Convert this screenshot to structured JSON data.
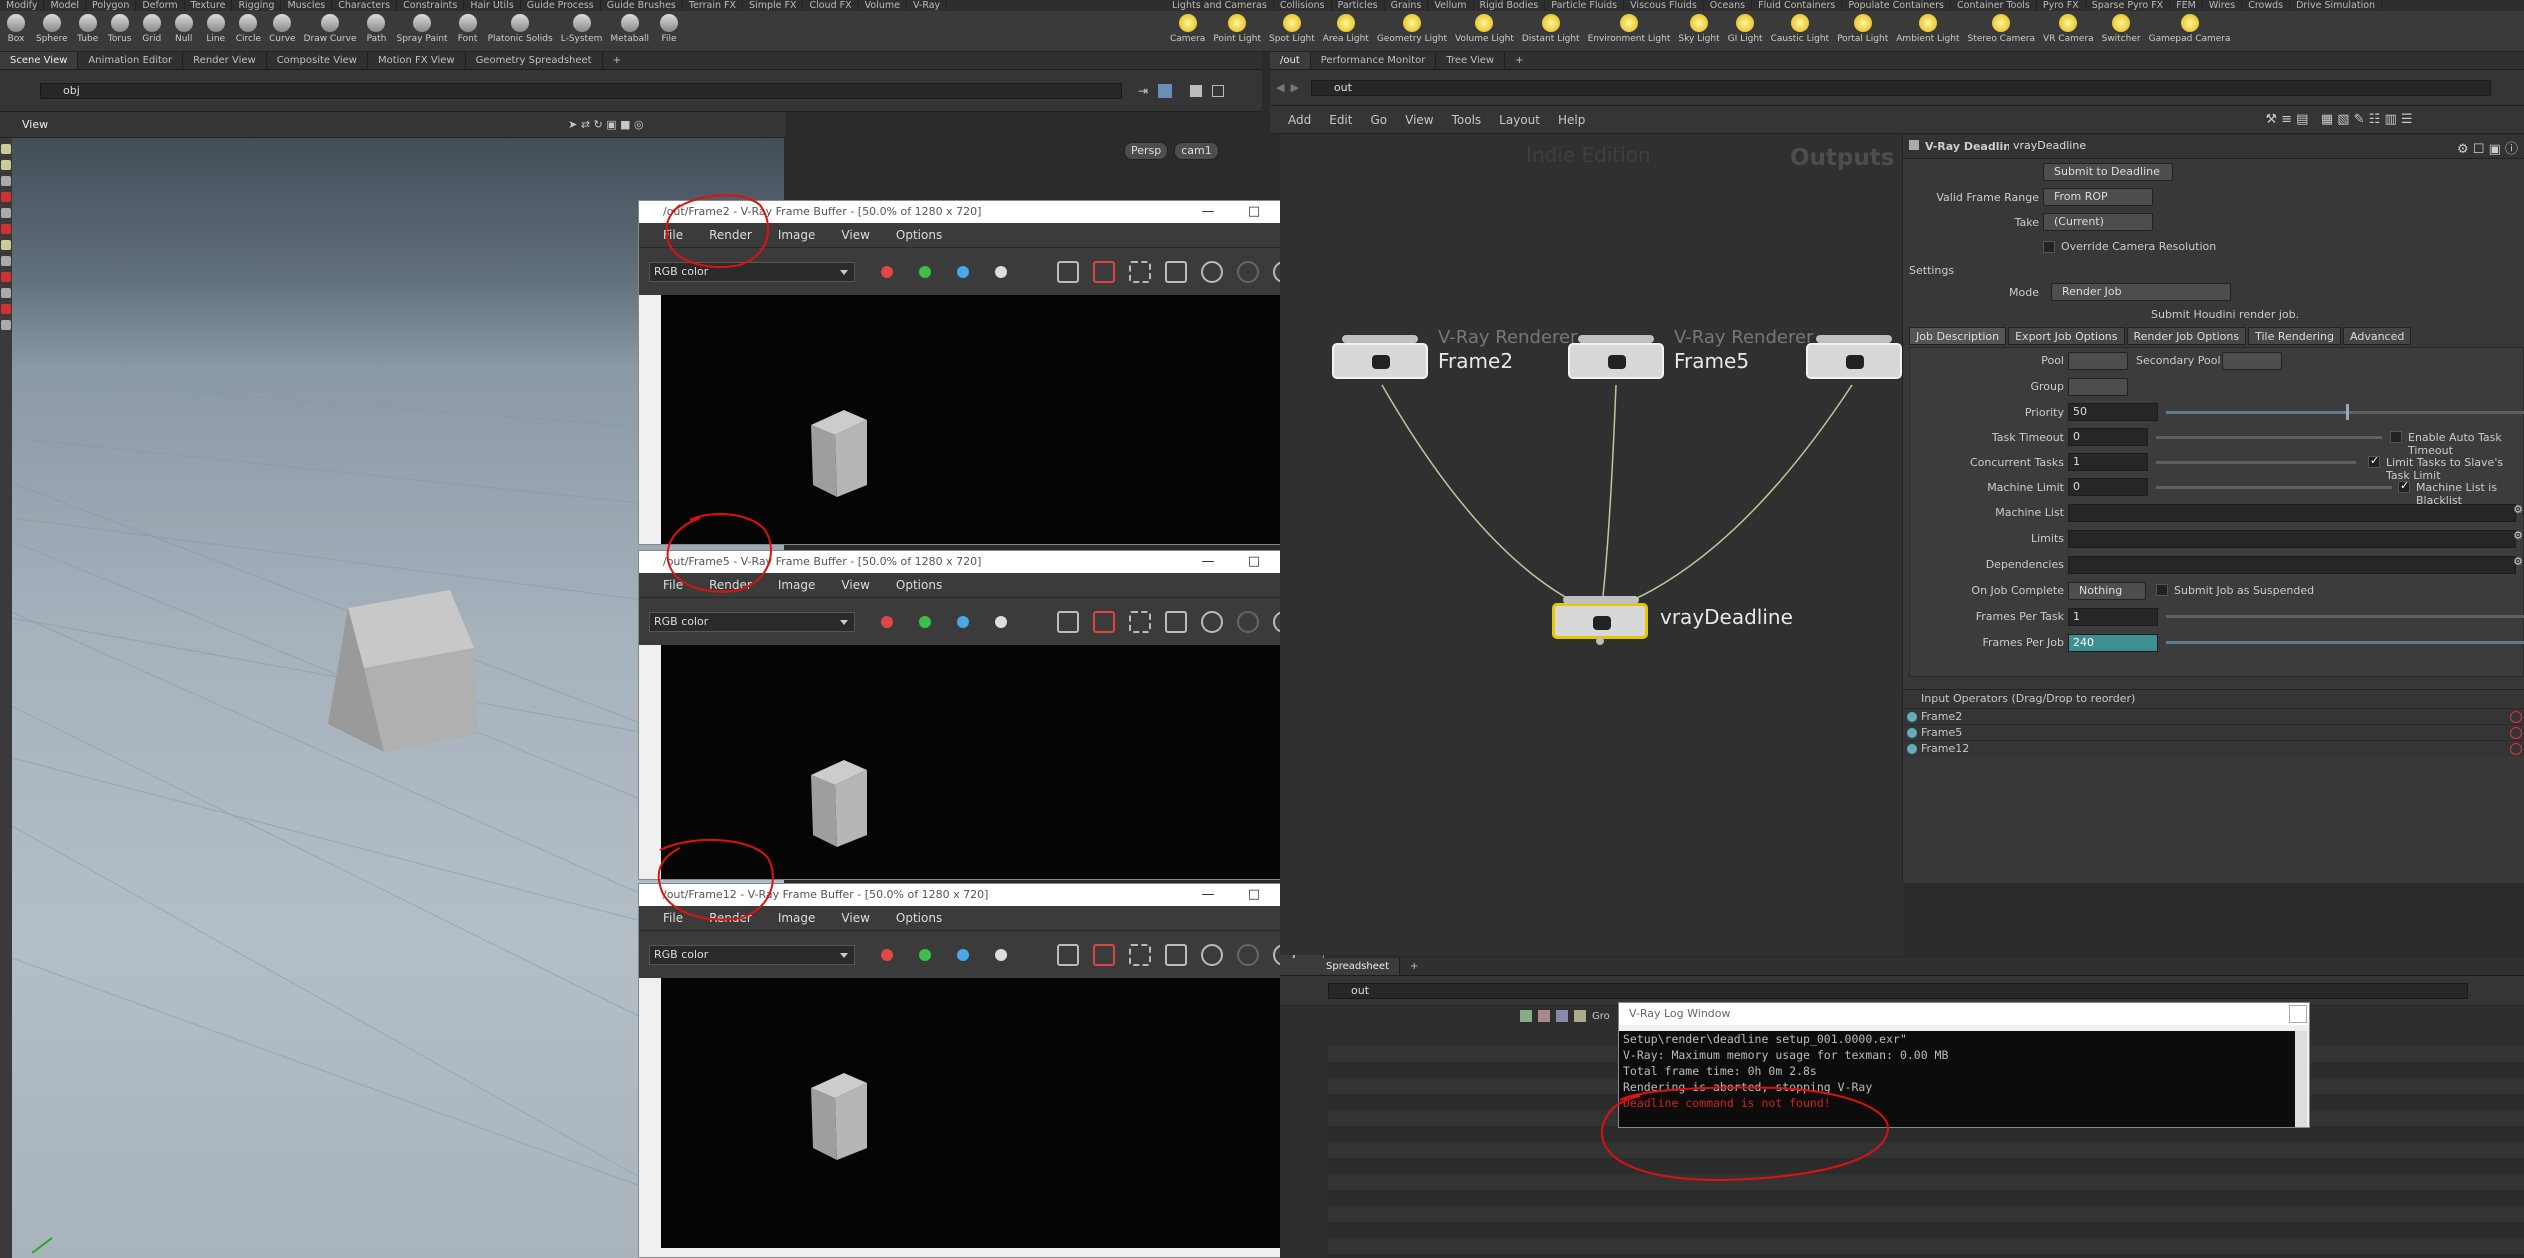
{
  "shelf_left": {
    "tabs": [
      "Modify",
      "Model",
      "Polygon",
      "Deform",
      "Texture",
      "Rigging",
      "Muscles",
      "Characters",
      "Constraints",
      "Hair Utils",
      "Guide Process",
      "Guide Brushes",
      "Terrain FX",
      "Simple FX",
      "Cloud FX",
      "Volume",
      "V-Ray"
    ],
    "tools": [
      "Box",
      "Sphere",
      "Tube",
      "Torus",
      "Grid",
      "Null",
      "Line",
      "Circle",
      "Curve",
      "Draw Curve",
      "Path",
      "Spray Paint",
      "Font",
      "Platonic Solids",
      "L-System",
      "Metaball",
      "File"
    ]
  },
  "shelf_right": {
    "tabs": [
      "Lights and Cameras",
      "Collisions",
      "Particles",
      "Grains",
      "Vellum",
      "Rigid Bodies",
      "Particle Fluids",
      "Viscous Fluids",
      "Oceans",
      "Fluid Containers",
      "Populate Containers",
      "Container Tools",
      "Pyro FX",
      "Sparse Pyro FX",
      "FEM",
      "Wires",
      "Crowds",
      "Drive Simulation"
    ],
    "tools": [
      "Camera",
      "Point Light",
      "Spot Light",
      "Area Light",
      "Geometry Light",
      "Volume Light",
      "Distant Light",
      "Environment Light",
      "Sky Light",
      "GI Light",
      "Caustic Light",
      "Portal Light",
      "Ambient Light",
      "Stereo Camera",
      "VR Camera",
      "Switcher",
      "Gamepad Camera"
    ]
  },
  "left_pane": {
    "tabs": [
      "Scene View",
      "Animation Editor",
      "Render View",
      "Composite View",
      "Motion FX View",
      "Geometry Spreadsheet"
    ],
    "path": "obj",
    "view_label": "View",
    "persp": "Persp",
    "camera": "cam1"
  },
  "vfb_windows": [
    {
      "title": "/out/Frame2 - V-Ray Frame Buffer - [50.0% of 1280 x 720]"
    },
    {
      "title": "/out/Frame5 - V-Ray Frame Buffer - [50.0% of 1280 x 720]"
    },
    {
      "title": "/out/Frame12 - V-Ray Frame Buffer - [50.0% of 1280 x 720]"
    }
  ],
  "vfb_menu": {
    "file": "File",
    "render": "Render",
    "image": "Image",
    "view": "View",
    "options": "Options"
  },
  "vfb_channel": "RGB color",
  "vfb_colors": {
    "red": "#e04848",
    "green": "#3cc048",
    "blue": "#48a8e8"
  },
  "right_pane": {
    "tabs": [
      "/out",
      "Performance Monitor",
      "Tree View"
    ],
    "path": "out",
    "menu": [
      "Add",
      "Edit",
      "Go",
      "View",
      "Tools",
      "Layout",
      "Help"
    ],
    "watermark": "Indie Edition",
    "context": "Outputs"
  },
  "nodes": [
    {
      "type": "V-Ray Renderer",
      "name": "Frame2"
    },
    {
      "type": "V-Ray Renderer",
      "name": "Frame5"
    },
    {
      "type": "",
      "name": ""
    },
    {
      "type": "",
      "name": "vrayDeadline"
    }
  ],
  "params": {
    "node_type": "V-Ray Deadline",
    "node_name": "vrayDeadline",
    "submit_button": "Submit to Deadline",
    "valid_frame_range_label": "Valid Frame Range",
    "valid_frame_range": "From ROP",
    "take_label": "Take",
    "take": "(Current)",
    "override_camera": "Override Camera Resolution",
    "settings_label": "Settings",
    "mode_label": "Mode",
    "mode": "Render Job",
    "mode_desc": "Submit Houdini render job.",
    "tabs": [
      "Job Description",
      "Export Job Options",
      "Render Job Options",
      "Tile Rendering",
      "Advanced"
    ],
    "pool_label": "Pool",
    "secondary_pool_label": "Secondary Pool",
    "group_label": "Group",
    "priority_label": "Priority",
    "priority": "50",
    "task_timeout_label": "Task Timeout",
    "task_timeout": "0",
    "enable_auto_timeout": "Enable Auto Task Timeout",
    "concurrent_label": "Concurrent Tasks",
    "concurrent": "1",
    "limit_slave": "Limit Tasks to Slave's Task Limit",
    "machine_limit_label": "Machine Limit",
    "machine_limit": "0",
    "machine_blacklist": "Machine List is Blacklist",
    "machine_list_label": "Machine List",
    "limits_label": "Limits",
    "dependencies_label": "Dependencies",
    "on_complete_label": "On Job Complete",
    "on_complete": "Nothing",
    "submit_suspended": "Submit Job as Suspended",
    "frames_per_task_label": "Frames Per Task",
    "frames_per_task": "1",
    "frames_per_job_label": "Frames Per Job",
    "frames_per_job": "240",
    "priority_level": 0.5,
    "inputs_header": "Input Operators (Drag/Drop to reorder)",
    "inputs": [
      "Frame2",
      "Frame5",
      "Frame12"
    ]
  },
  "bottom": {
    "tab": "Spreadsheet",
    "path": "out",
    "gro": "Gro"
  },
  "log": {
    "title": "V-Ray Log Window",
    "lines": [
      {
        "text": "Setup\\render\\deadline setup_001.0000.exr\"",
        "error": false
      },
      {
        "text": "V-Ray: Maximum memory usage for texman: 0.00 MB",
        "error": false
      },
      {
        "text": "Total frame time: 0h 0m 2.8s",
        "error": false
      },
      {
        "text": "Rendering is aborted, stopping V-Ray",
        "error": false
      },
      {
        "text": "Deadline command is not found!",
        "error": true
      }
    ]
  }
}
